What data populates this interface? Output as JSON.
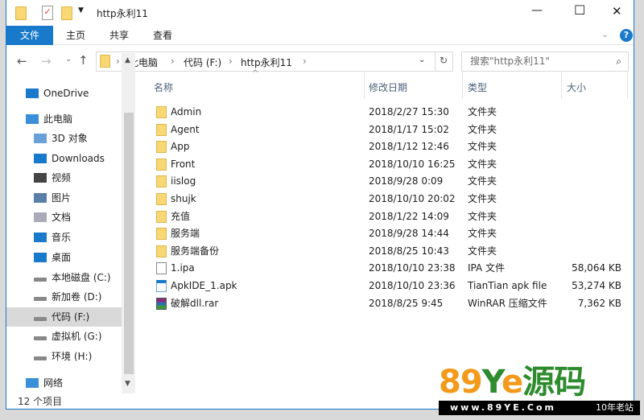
{
  "window": {
    "title": "http永利11",
    "minimize": "—",
    "maximize": "☐",
    "close": "✕"
  },
  "ribbon": {
    "tabs": [
      "文件",
      "主页",
      "共享",
      "查看"
    ],
    "help": "?"
  },
  "address": {
    "crumbs": [
      "此电脑",
      "代码 (F:)",
      "http永利11"
    ],
    "search_placeholder": "搜索\"http永利11\""
  },
  "nav": {
    "items": [
      {
        "label": "OneDrive",
        "icon": "onedrive-icon"
      },
      {
        "label": "此电脑",
        "icon": "computer-icon"
      },
      {
        "label": "3D 对象",
        "icon": "3d-objects-icon"
      },
      {
        "label": "Downloads",
        "icon": "downloads-icon"
      },
      {
        "label": "视频",
        "icon": "video-icon"
      },
      {
        "label": "图片",
        "icon": "pictures-icon"
      },
      {
        "label": "文档",
        "icon": "documents-icon"
      },
      {
        "label": "音乐",
        "icon": "music-icon"
      },
      {
        "label": "桌面",
        "icon": "desktop-icon"
      },
      {
        "label": "本地磁盘 (C:)",
        "icon": "drive-icon"
      },
      {
        "label": "新加卷 (D:)",
        "icon": "drive-icon"
      },
      {
        "label": "代码 (F:)",
        "icon": "drive-icon",
        "selected": true
      },
      {
        "label": "虚拟机 (G:)",
        "icon": "drive-icon"
      },
      {
        "label": "环境 (H:)",
        "icon": "drive-icon"
      },
      {
        "label": "网络",
        "icon": "network-icon"
      }
    ]
  },
  "columns": {
    "name": "名称",
    "date": "修改日期",
    "type": "类型",
    "size": "大小"
  },
  "files": [
    {
      "name": "Admin",
      "date": "2018/2/27 15:30",
      "type": "文件夹",
      "size": "",
      "icon": "folder"
    },
    {
      "name": "Agent",
      "date": "2018/1/17 15:02",
      "type": "文件夹",
      "size": "",
      "icon": "folder"
    },
    {
      "name": "App",
      "date": "2018/1/12 12:46",
      "type": "文件夹",
      "size": "",
      "icon": "folder"
    },
    {
      "name": "Front",
      "date": "2018/10/10 16:25",
      "type": "文件夹",
      "size": "",
      "icon": "folder"
    },
    {
      "name": "iislog",
      "date": "2018/9/28 0:09",
      "type": "文件夹",
      "size": "",
      "icon": "folder"
    },
    {
      "name": "shujk",
      "date": "2018/10/10 20:02",
      "type": "文件夹",
      "size": "",
      "icon": "folder"
    },
    {
      "name": "充值",
      "date": "2018/1/22 14:09",
      "type": "文件夹",
      "size": "",
      "icon": "folder"
    },
    {
      "name": "服务端",
      "date": "2018/9/28 14:44",
      "type": "文件夹",
      "size": "",
      "icon": "folder"
    },
    {
      "name": "服务端备份",
      "date": "2018/8/25 10:43",
      "type": "文件夹",
      "size": "",
      "icon": "folder"
    },
    {
      "name": "1.ipa",
      "date": "2018/10/10 23:38",
      "type": "IPA 文件",
      "size": "58,064 KB",
      "icon": "file"
    },
    {
      "name": "ApkIDE_1.apk",
      "date": "2018/10/10 23:36",
      "type": "TianTian apk file",
      "size": "53,274 KB",
      "icon": "apk"
    },
    {
      "name": "破解dll.rar",
      "date": "2018/8/25 9:45",
      "type": "WinRAR 压缩文件",
      "size": "7,362 KB",
      "icon": "rar"
    }
  ],
  "status": {
    "count": "12 个项目"
  },
  "watermark": {
    "logo": "89Ye源码",
    "url": "www.89YE.Com",
    "tag": "10年老站"
  }
}
